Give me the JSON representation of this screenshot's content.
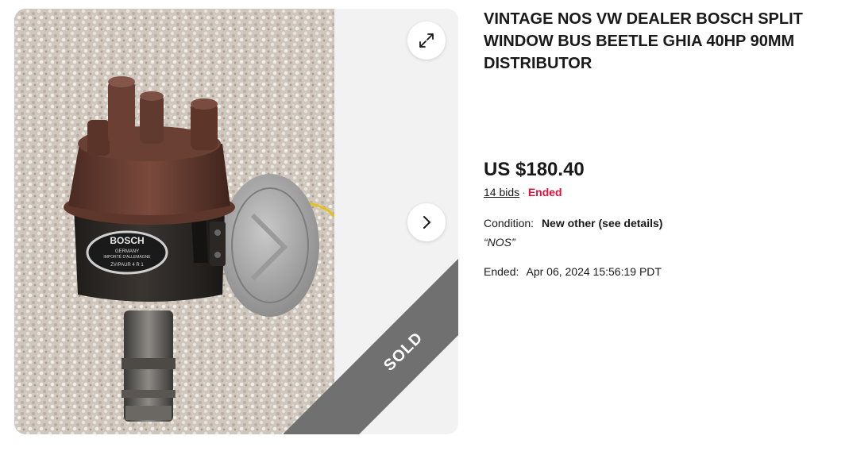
{
  "listing": {
    "title": "VINTAGE NOS VW DEALER BOSCH SPLIT WINDOW BUS BEETLE GHIA 40HP 90MM DISTRIBUTOR",
    "price": "US $180.40",
    "bids": "14 bids",
    "separator": "·",
    "status": "Ended",
    "condition_label": "Condition:",
    "condition_value": "New other (see details)",
    "seller_note": "“NOS”",
    "ended_label": "Ended:",
    "ended_value": "Apr 06, 2024 15:56:19 PDT"
  },
  "gallery": {
    "sold_label": "SOLD",
    "plate_brand": "BOSCH",
    "plate_country": "GERMANY",
    "plate_import": "IMPORTÉ D'ALLEMAGNE",
    "plate_code": "ZV/PAUR 4 R 1",
    "expand_icon": "expand-icon",
    "next_icon": "chevron-right-icon"
  },
  "colors": {
    "status_ended": "#e0103a",
    "sold_ribbon": "#707070",
    "gallery_bg": "#f2f2f2"
  }
}
